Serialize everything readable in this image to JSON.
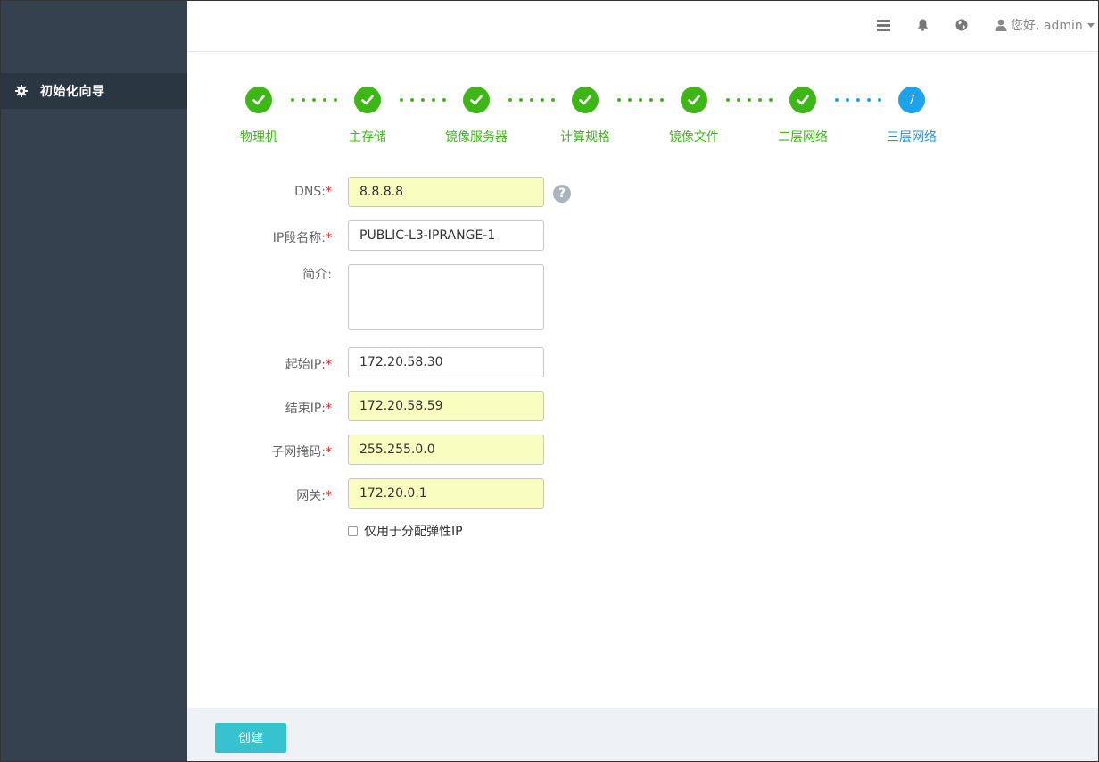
{
  "sidebar": {
    "items": [
      {
        "label": "初始化向导",
        "icon": "gear-icon"
      }
    ]
  },
  "header": {
    "icons": [
      "list-icon",
      "bell-icon",
      "globe-icon"
    ],
    "user": {
      "greeting": "您好, admin",
      "icon": "user-icon"
    }
  },
  "wizard": {
    "steps": [
      {
        "label": "物理机",
        "status": "done"
      },
      {
        "label": "主存储",
        "status": "done"
      },
      {
        "label": "镜像服务器",
        "status": "done"
      },
      {
        "label": "计算规格",
        "status": "done"
      },
      {
        "label": "镜像文件",
        "status": "done"
      },
      {
        "label": "二层网络",
        "status": "done"
      },
      {
        "label": "三层网络",
        "status": "active",
        "number": "7"
      }
    ]
  },
  "form": {
    "dns": {
      "label": "DNS:",
      "value": "8.8.8.8",
      "required": true,
      "help": "?"
    },
    "ip_range_name": {
      "label": "IP段名称:",
      "value": "PUBLIC-L3-IPRANGE-1",
      "required": true
    },
    "description": {
      "label": "简介:",
      "value": ""
    },
    "start_ip": {
      "label": "起始IP:",
      "value": "172.20.58.30",
      "required": true
    },
    "end_ip": {
      "label": "结束IP:",
      "value": "172.20.58.59",
      "required": true
    },
    "netmask": {
      "label": "子网掩码:",
      "value": "255.255.0.0",
      "required": true
    },
    "gateway": {
      "label": "网关:",
      "value": "172.20.0.1",
      "required": true
    },
    "eip_only": {
      "label": "仅用于分配弹性IP",
      "checked": false
    },
    "required_mark": "*"
  },
  "footer": {
    "create_label": "创建"
  },
  "colors": {
    "sidebar_bg": "#364150",
    "sidebar_active": "#2b3643",
    "step_done": "#3fb618",
    "step_active": "#1ea2ec",
    "autofill_yellow": "#fafdc0",
    "create_button": "#36c2cf",
    "required": "#e02222"
  }
}
